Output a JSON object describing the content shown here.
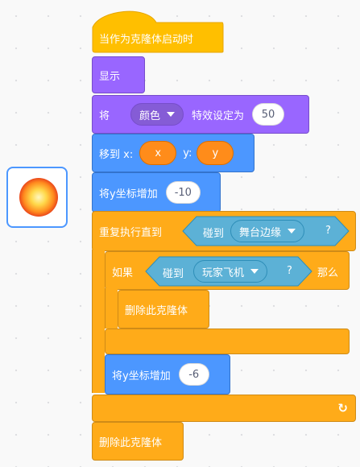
{
  "sprite": {
    "icon": "sprite-thumbnail-icon"
  },
  "script": {
    "hat": "当作为克隆体启动时",
    "show": "显示",
    "effect": {
      "prefix": "将",
      "effect_name": "颜色",
      "mid": "特效设定为",
      "value": "50"
    },
    "goto": {
      "label": "移到 x:",
      "x_value": "x",
      "y_label": "y:",
      "y_value": "y"
    },
    "change_y_1": {
      "label": "将y坐标增加",
      "value": "-10"
    },
    "repeat_until": {
      "label": "重复执行直到",
      "touching_label": "碰到",
      "touching_target": "舞台边缘",
      "question": "?"
    },
    "if": {
      "label": "如果",
      "touching_label": "碰到",
      "touching_target": "玩家飞机",
      "question": "?",
      "then": "那么"
    },
    "delete_inner": "删除此克隆体",
    "change_y_2": {
      "label": "将y坐标增加",
      "value": "-6"
    },
    "loop_arrow": "↻",
    "delete_final": "删除此克隆体"
  },
  "colors": {
    "events": "#ffbf00",
    "looks": "#9966ff",
    "motion": "#4c97ff",
    "control": "#ffab19",
    "sensing": "#5cb1d6",
    "reporter": "#ff8c1a"
  }
}
